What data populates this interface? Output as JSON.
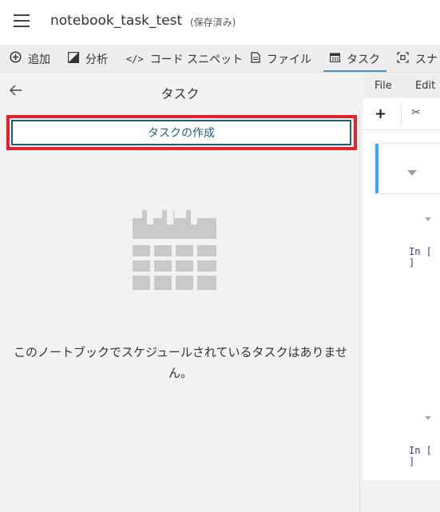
{
  "titlebar": {
    "notebook_name": "notebook_task_test",
    "save_status": "(保存済み)"
  },
  "toolbar": {
    "items": [
      {
        "label": "追加",
        "icon": "plus-circle-icon"
      },
      {
        "label": "分析",
        "icon": "analysis-icon"
      },
      {
        "label": "コード スニペット",
        "icon": "code-icon"
      },
      {
        "label": "ファイル",
        "icon": "file-icon"
      },
      {
        "label": "タスク",
        "icon": "calendar-icon",
        "active": true
      },
      {
        "label": "スナ",
        "icon": "snapshot-icon"
      }
    ],
    "active_color": "#4a8ec2"
  },
  "panel": {
    "title": "タスク",
    "create_button": "タスクの作成",
    "empty_message": "このノートブックでスケジュールされているタスクはありません。",
    "highlight_color": "#e8202a",
    "button_color": "#1f5f7a"
  },
  "notebook": {
    "menu": [
      "File",
      "Edit"
    ],
    "toolbar": {
      "add_icon": "+",
      "cut_icon": "scissors-icon"
    },
    "prompts": [
      "In [ ]",
      "In [ ]"
    ],
    "cell_accent": "#42a5f5"
  }
}
